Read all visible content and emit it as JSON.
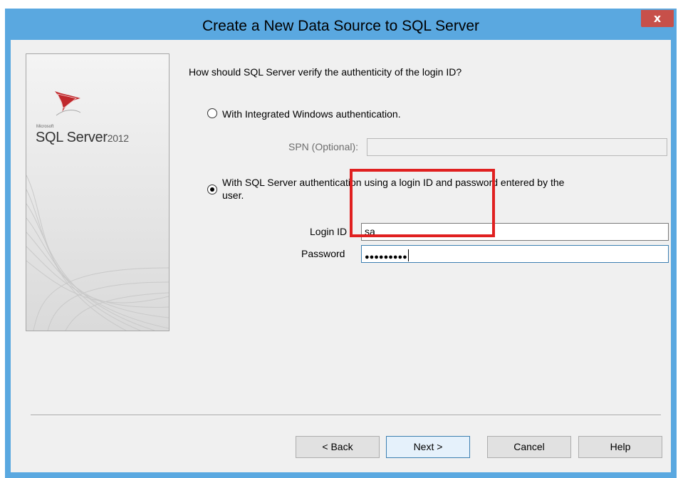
{
  "window": {
    "title": "Create a New Data Source to SQL Server",
    "close_label": "x"
  },
  "logo": {
    "brand": "Microsoft",
    "product": "SQL Server",
    "year": "2012"
  },
  "question": "How should SQL Server verify the authenticity of the login ID?",
  "options": {
    "integrated": {
      "label": "With Integrated Windows authentication.",
      "checked": false
    },
    "spn": {
      "label": "SPN (Optional):",
      "value": ""
    },
    "sql_auth": {
      "label_line1": "With SQL Server authentication using a login ID and password entered by the",
      "label_line2": "user.",
      "checked": true
    }
  },
  "login": {
    "label": "Login ID",
    "value": "sa"
  },
  "password": {
    "label": "Password",
    "masked_value": "●●●●●●●●●"
  },
  "buttons": {
    "back": "< Back",
    "next": "Next >",
    "cancel": "Cancel",
    "help": "Help"
  },
  "colors": {
    "titlebar": "#5aa8e0",
    "close": "#c7504a",
    "highlight": "#e02020"
  }
}
